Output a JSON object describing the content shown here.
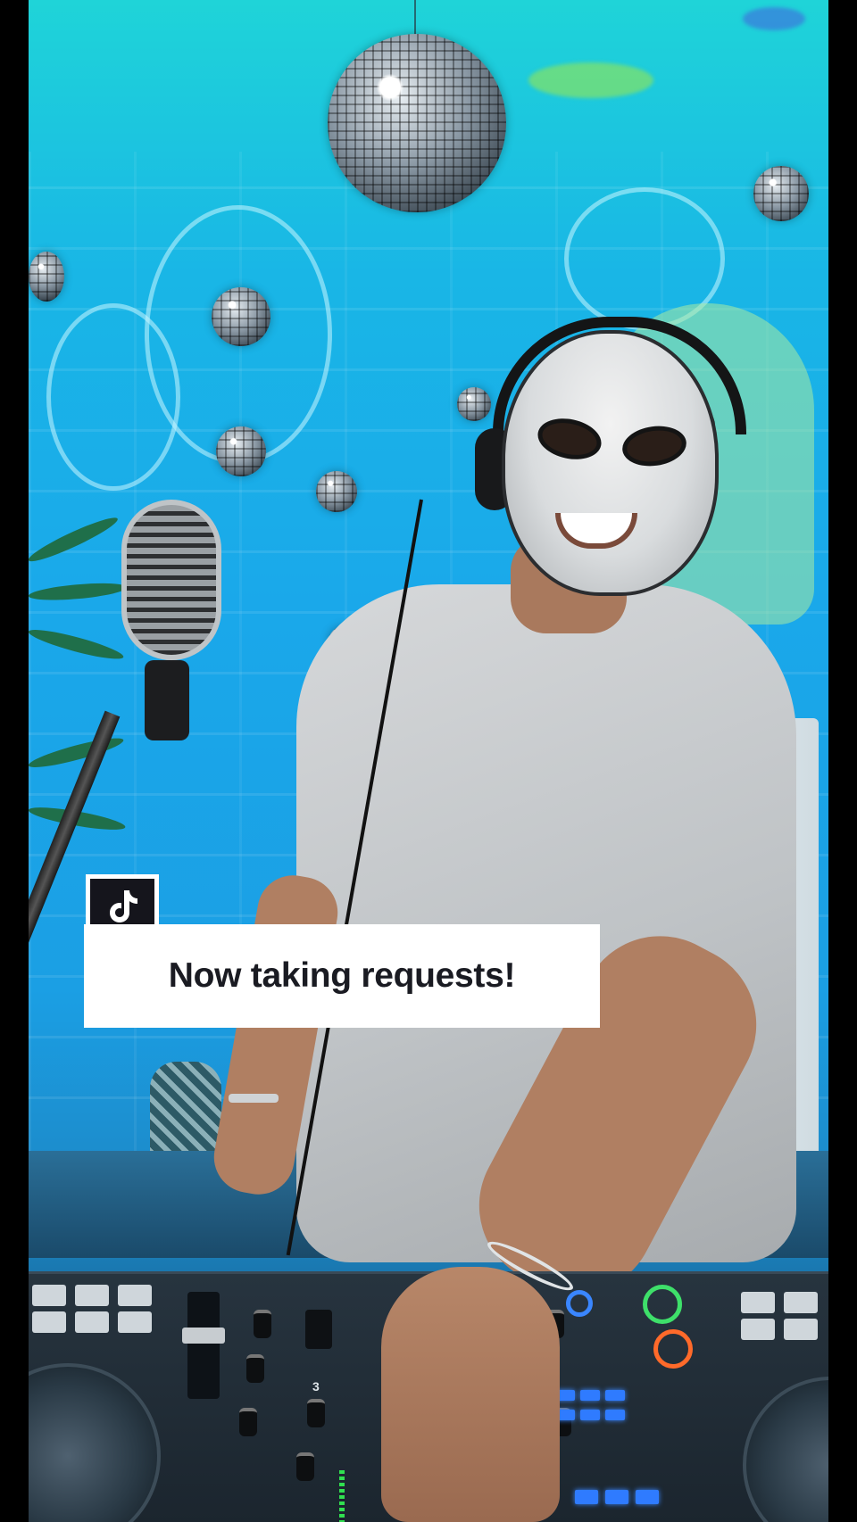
{
  "caption": {
    "text": "Now taking requests!"
  },
  "badge": {
    "icon": "tiktok-logo-icon"
  },
  "controller": {
    "channel_number": "3"
  },
  "colors": {
    "wall": "#1aa8ea",
    "caption_bg": "#ffffff",
    "caption_text": "#1a1b22",
    "badge_bg": "#15151c"
  }
}
